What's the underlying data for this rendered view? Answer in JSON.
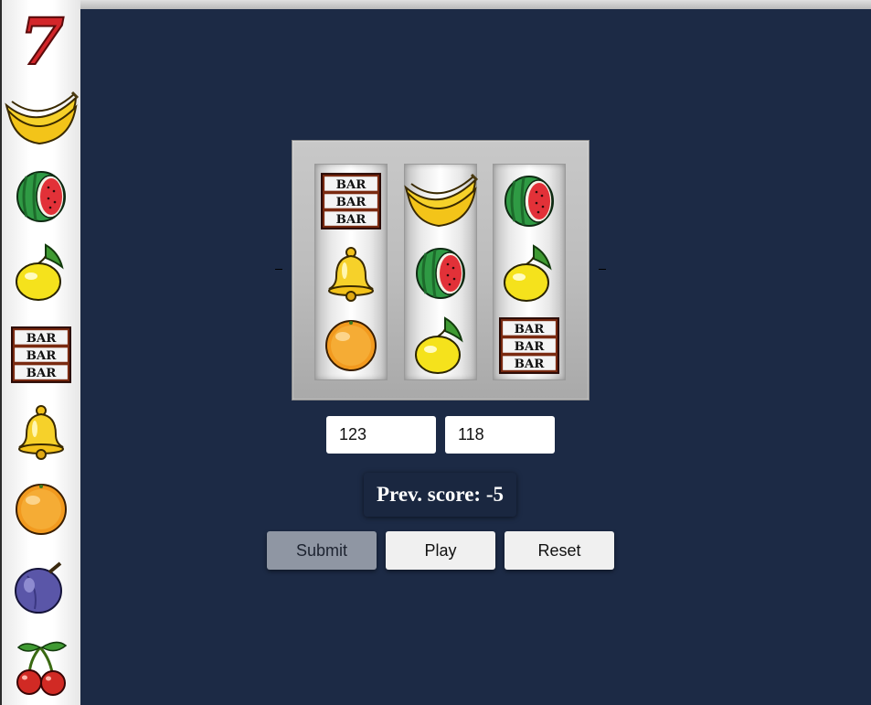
{
  "paytable": {
    "symbols": [
      "seven-icon",
      "banana-icon",
      "watermelon-icon",
      "lemon-icon",
      "bar-icon",
      "bell-icon",
      "orange-icon",
      "plum-icon",
      "cherry-icon"
    ]
  },
  "reels": [
    [
      "bar-icon",
      "bell-icon",
      "orange-icon"
    ],
    [
      "banana-icon",
      "watermelon-icon",
      "lemon-icon"
    ],
    [
      "watermelon-icon",
      "lemon-icon",
      "bar-icon"
    ]
  ],
  "bar_text": "BAR",
  "seven_text": "7",
  "inputs": {
    "first_value": "123",
    "second_value": "118"
  },
  "score": {
    "text": "Prev. score: -5"
  },
  "buttons": {
    "submit_label": "Submit",
    "play_label": "Play",
    "reset_label": "Reset"
  },
  "colors": {
    "background": "#1c2a45",
    "score_panel": "#1a2740",
    "submit_disabled": "#8f96a3"
  }
}
